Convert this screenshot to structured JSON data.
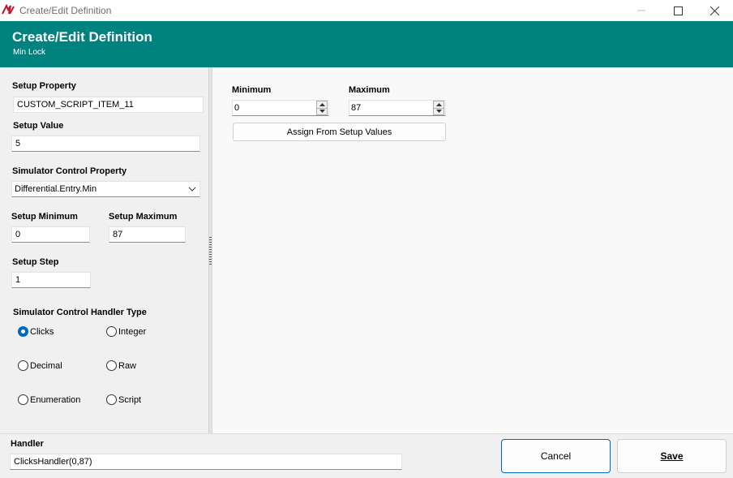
{
  "window": {
    "title": "Create/Edit Definition",
    "app_icon": "app-logo-icon"
  },
  "header": {
    "title": "Create/Edit Definition",
    "subtitle": "Min Lock",
    "background_color": "#00837e"
  },
  "left": {
    "setup_property": {
      "label": "Setup Property",
      "value": "CUSTOM_SCRIPT_ITEM_11"
    },
    "setup_value": {
      "label": "Setup Value",
      "value": "5"
    },
    "simulator_control_property": {
      "label": "Simulator Control Property",
      "value": "Differential.Entry.Min"
    },
    "setup_minimum": {
      "label": "Setup Minimum",
      "value": "0"
    },
    "setup_maximum": {
      "label": "Setup Maximum",
      "value": "87"
    },
    "setup_step": {
      "label": "Setup Step",
      "value": "1"
    },
    "handler_type": {
      "label": "Simulator Control Handler Type",
      "selected": "Clicks",
      "options": [
        "Clicks",
        "Integer",
        "Decimal",
        "Raw",
        "Enumeration",
        "Script"
      ]
    }
  },
  "right": {
    "minimum": {
      "label": "Minimum",
      "value": "0"
    },
    "maximum": {
      "label": "Maximum",
      "value": "87"
    },
    "assign_button": "Assign From Setup Values"
  },
  "bottom": {
    "handler": {
      "label": "Handler",
      "value": "ClicksHandler(0,87)"
    },
    "cancel_label": "Cancel",
    "save_label": "Save"
  },
  "accent_color": "#0067c0"
}
